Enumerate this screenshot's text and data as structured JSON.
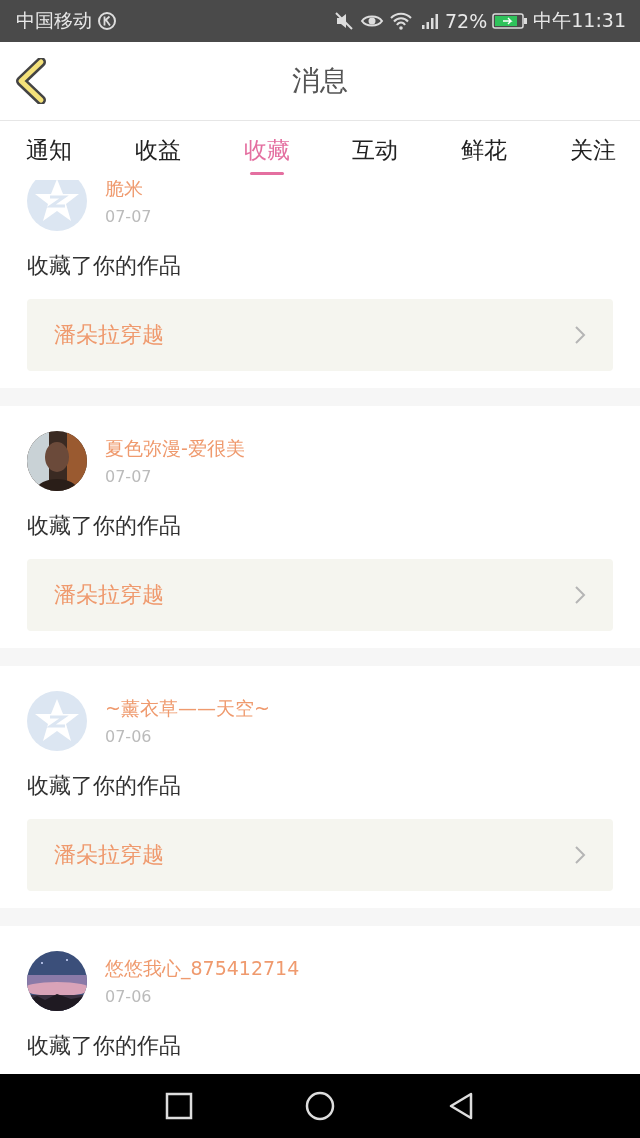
{
  "status_bar": {
    "carrier": "中国移动",
    "battery": "72%",
    "time": "中午11:31"
  },
  "header": {
    "title": "消息"
  },
  "tabs": [
    {
      "label": "通知",
      "selected": false
    },
    {
      "label": "收益",
      "selected": false
    },
    {
      "label": "收藏",
      "selected": true
    },
    {
      "label": "互动",
      "selected": false
    },
    {
      "label": "鲜花",
      "selected": false
    },
    {
      "label": "关注",
      "selected": false
    }
  ],
  "messages": [
    {
      "user": "脆米",
      "kind": "default",
      "date": "07-07",
      "action": "收藏了你的作品",
      "work": "潘朵拉穿越"
    },
    {
      "user": "夏色弥漫-爱很美",
      "kind": "picture",
      "date": "07-07",
      "action": "收藏了你的作品",
      "work": "潘朵拉穿越"
    },
    {
      "user": "~薰衣草——天空~",
      "kind": "default",
      "date": "07-06",
      "action": "收藏了你的作品",
      "work": "潘朵拉穿越"
    },
    {
      "user": "悠悠我心_875412714",
      "kind": "picture",
      "date": "07-06",
      "action": "收藏了你的作品"
    }
  ]
}
